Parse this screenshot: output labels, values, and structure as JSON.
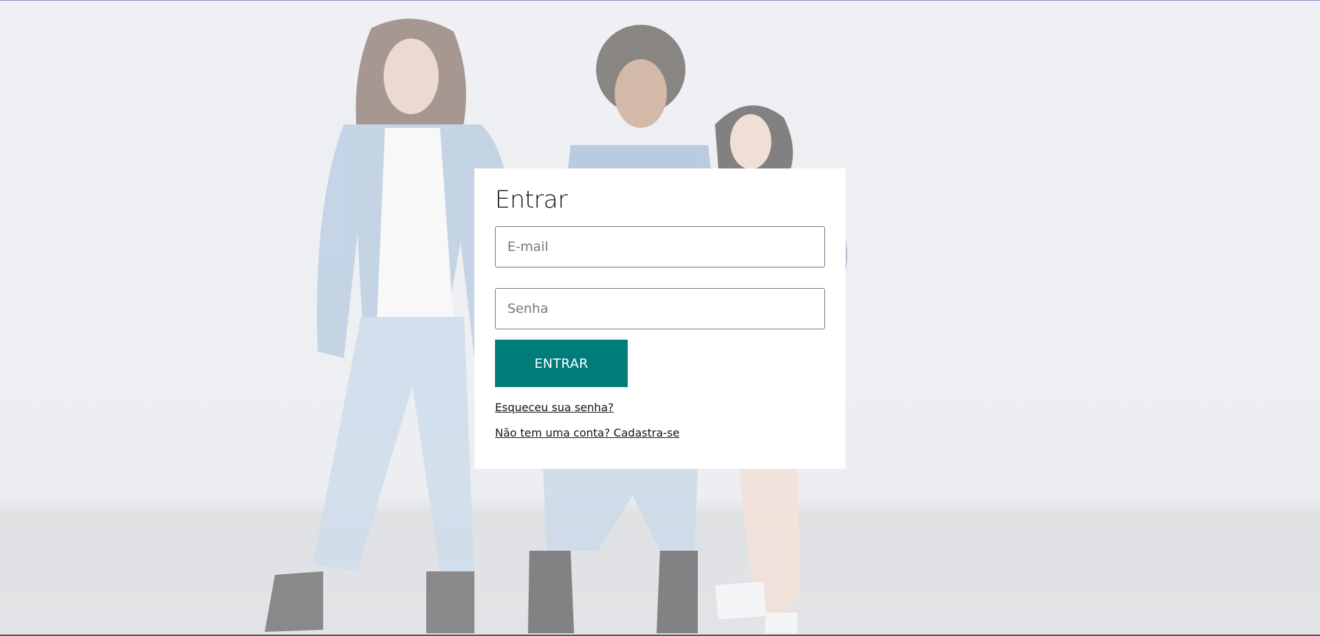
{
  "login": {
    "title": "Entrar",
    "email_placeholder": "E-mail",
    "password_placeholder": "Senha",
    "submit_label": "ENTRAR",
    "forgot_password_link": "Esqueceu sua senha?",
    "signup_link": "Não tem uma conta? Cadastra-se"
  },
  "colors": {
    "accent": "#007d7a",
    "card_background": "#ffffff",
    "top_border": "#8b7fc6"
  }
}
